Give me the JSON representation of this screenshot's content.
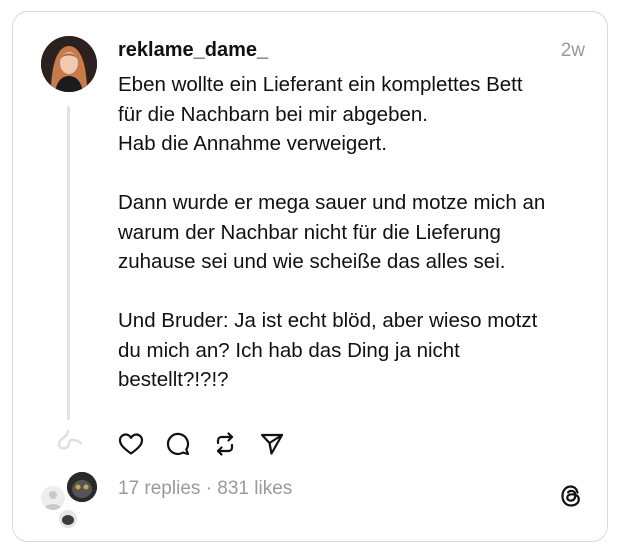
{
  "post": {
    "username": "reklame_dame_",
    "time": "2w",
    "paragraphs": [
      "Eben wollte ein Lieferant ein komplettes Bett\nfür die Nachbarn bei mir abgeben.\nHab die Annahme verweigert.",
      "Dann wurde er mega sauer und motze mich an\nwarum der Nachbar nicht für die Lieferung\nzuhause sei und wie scheiße das alles sei.",
      "Und Bruder: Ja ist echt blöd, aber wieso motzt\ndu mich an? Ich hab das Ding ja nicht\nbestellt?!?!?"
    ],
    "stats": {
      "replies": "17 replies",
      "separator": "·",
      "likes": "831 likes"
    }
  },
  "icons": {
    "like": "heart-icon",
    "reply": "comment-icon",
    "repost": "repost-icon",
    "share": "send-icon",
    "brand": "threads-logo"
  },
  "colors": {
    "text": "#111111",
    "muted": "#9a9a9a",
    "border": "#d9d9d9",
    "thread_line": "#e3e3e3"
  }
}
